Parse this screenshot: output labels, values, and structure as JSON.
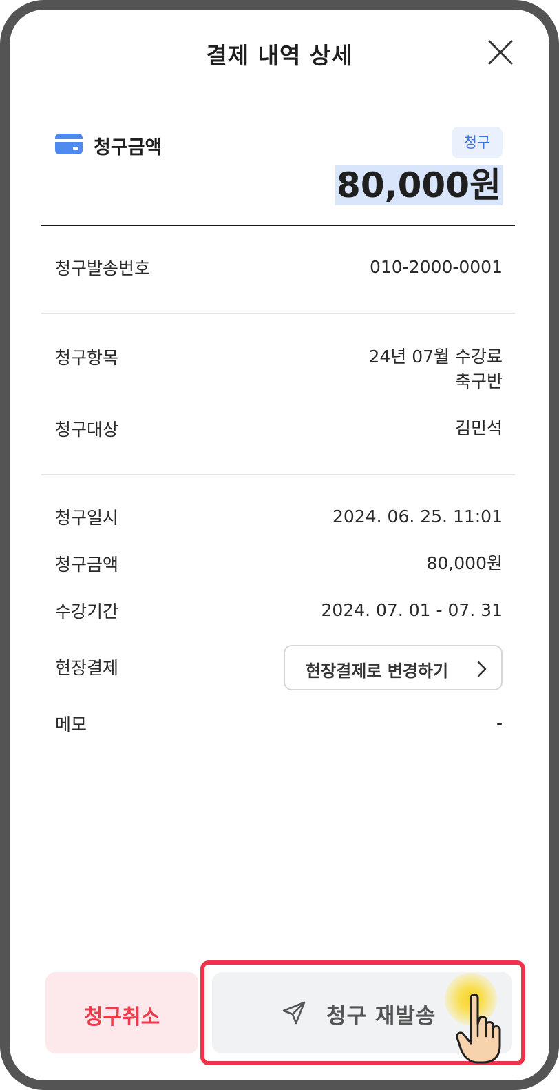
{
  "header": {
    "title": "결제 내역 상세"
  },
  "summary": {
    "label": "청구금액",
    "badge": "청구",
    "amount": "80,000원"
  },
  "details": {
    "phone": {
      "label": "청구발송번호",
      "value": "010-2000-0001"
    },
    "item": {
      "label": "청구항목",
      "value_line1": "24년 07월 수강료",
      "value_line2": "축구반"
    },
    "target": {
      "label": "청구대상",
      "value": "김민석"
    },
    "datetime": {
      "label": "청구일시",
      "value": "2024. 06. 25. 11:01"
    },
    "amount": {
      "label": "청구금액",
      "value": "80,000원"
    },
    "period": {
      "label": "수강기간",
      "value": "2024. 07. 01 - 07. 31"
    },
    "onsite": {
      "label": "현장결제",
      "button": "현장결제로 변경하기"
    },
    "memo": {
      "label": "메모",
      "value": "-"
    }
  },
  "footer": {
    "cancel_label": "청구취소",
    "resend_label": "청구 재발송"
  },
  "colors": {
    "accent_blue": "#3b74e0",
    "cancel_red": "#ee3b4b",
    "highlight_red": "#f0324b",
    "tap_yellow": "#f8d22a"
  },
  "icons": [
    "close-icon",
    "credit-card-icon",
    "chevron-right-icon",
    "send-icon",
    "pointer-hand-icon"
  ]
}
